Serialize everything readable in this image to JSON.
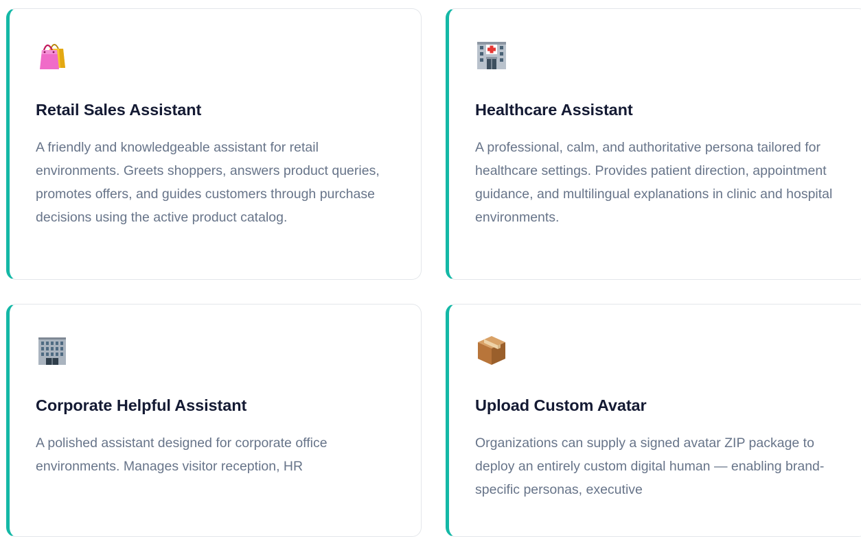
{
  "cards": [
    {
      "icon": "shopping-bags-icon",
      "title": "Retail Sales Assistant",
      "description": "A friendly and knowledgeable assistant for retail environments. Greets shoppers, answers product queries, promotes offers, and guides customers through purchase decisions using the active product catalog."
    },
    {
      "icon": "hospital-icon",
      "title": "Healthcare Assistant",
      "description": "A professional, calm, and authoritative persona tailored for healthcare settings. Provides patient direction, appointment guidance, and multilingual explanations in clinic and hospital environments."
    },
    {
      "icon": "office-building-icon",
      "title": "Corporate Helpful Assistant",
      "description": "A polished assistant designed for corporate office environments. Manages visitor reception, HR"
    },
    {
      "icon": "package-icon",
      "title": "Upload Custom Avatar",
      "description": "Organizations can supply a signed avatar ZIP package to deploy an entirely custom digital human — enabling brand-specific personas, executive"
    }
  ],
  "colors": {
    "accent": "#14b8a6",
    "title": "#141a33",
    "description": "#677489",
    "border": "#e3e6ea"
  }
}
